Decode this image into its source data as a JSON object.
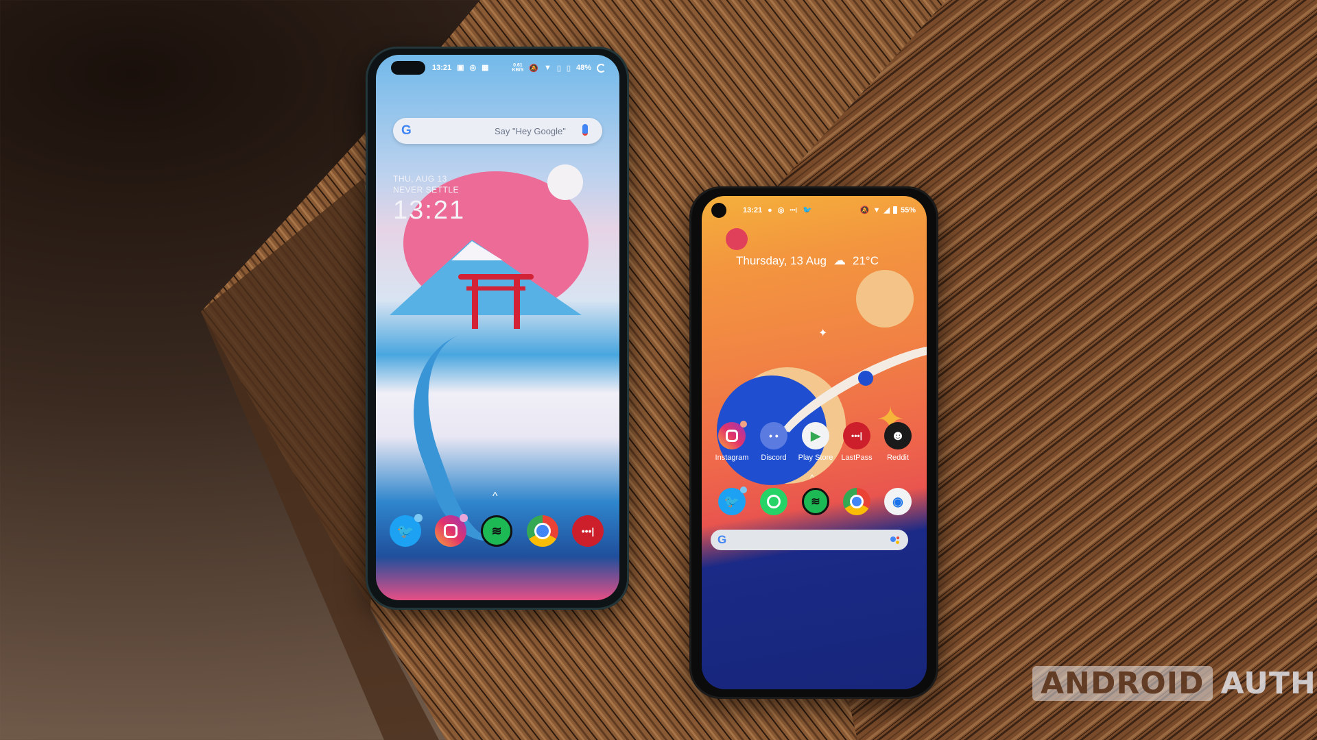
{
  "scene": {
    "description": "Two Android smartphones lying on a wooden table",
    "watermark": {
      "part1": "ANDROID",
      "part2": "AUTHORITY"
    }
  },
  "left_phone": {
    "status_bar": {
      "time": "13:21",
      "notification_icons": [
        "twitch-icon",
        "instagram-icon",
        "gallery-icon"
      ],
      "net_speed": "0.61",
      "net_speed_unit": "KB/S",
      "system_icons": [
        "mute-icon",
        "wifi-icon",
        "no-sim-icon",
        "no-sim-icon"
      ],
      "battery": "48%"
    },
    "search_bar": {
      "logo": "G",
      "placeholder": "Say \"Hey Google\"",
      "mic_icon": "mic-icon"
    },
    "clock_widget": {
      "date": "THU, AUG 13",
      "tagline": "NEVER SETTLE",
      "time": "13:21"
    },
    "drawer_hint": "^",
    "dock": [
      {
        "name": "Twitter",
        "color": "#1da1f2",
        "badge": true
      },
      {
        "name": "Instagram",
        "color": "#d62976",
        "badge": true
      },
      {
        "name": "Spotify",
        "color": "#1db954",
        "badge": false
      },
      {
        "name": "Chrome",
        "color": "#4285f4",
        "badge": false
      },
      {
        "name": "LastPass",
        "color": "#cc1f2b",
        "badge": false
      }
    ]
  },
  "right_phone": {
    "status_bar": {
      "time": "13:21",
      "notification_icons": [
        "spotify-icon",
        "instagram-icon",
        "lastpass-icon",
        "twitter-icon"
      ],
      "system_icons": [
        "mute-icon",
        "wifi-icon",
        "signal-icon",
        "battery-icon"
      ],
      "battery": "55%"
    },
    "at_a_glance": {
      "date": "Thursday, 13 Aug",
      "weather_icon": "partly-cloudy-icon",
      "temperature": "21°C"
    },
    "app_row": [
      {
        "name": "Instagram",
        "color": "#d62976",
        "badge": true
      },
      {
        "name": "Discord",
        "color": "#5865f2",
        "badge": false
      },
      {
        "name": "Play Store",
        "color": "#f1f3f4",
        "badge": false
      },
      {
        "name": "LastPass",
        "color": "#cc1f2b",
        "badge": false
      },
      {
        "name": "Reddit",
        "color": "#1a1a1b",
        "badge": false
      }
    ],
    "drawer_hint": "^",
    "dock": [
      {
        "name": "Twitter",
        "color": "#1da1f2",
        "badge": true
      },
      {
        "name": "WhatsApp",
        "color": "#25d366",
        "badge": false
      },
      {
        "name": "Spotify",
        "color": "#1db954",
        "badge": false
      },
      {
        "name": "Chrome",
        "color": "#4285f4",
        "badge": false
      },
      {
        "name": "Camera",
        "color": "#f1f3f4",
        "badge": false
      }
    ],
    "search_bar": {
      "logo": "G",
      "assistant_icon": "google-assistant-icon"
    }
  },
  "glyphs": {
    "lastpass": "•••|",
    "twitter": "🐦",
    "play": "▶",
    "camera": "◉",
    "discord": "• •",
    "reddit": "☻",
    "mic": "🎤",
    "cloud": "☁",
    "wifi": "▼",
    "bell_off": "🔕"
  }
}
